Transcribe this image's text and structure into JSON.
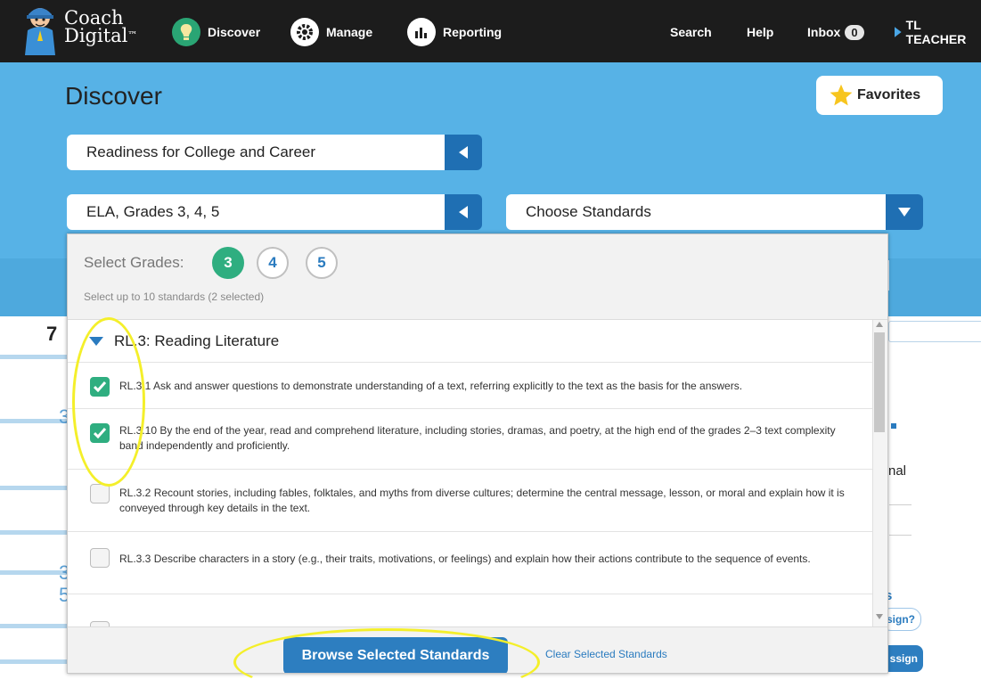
{
  "nav": {
    "logo_line1": "Coach",
    "logo_line2": "Digital",
    "logo_tm": "™",
    "discover": "Discover",
    "manage": "Manage",
    "reporting": "Reporting",
    "search": "Search",
    "help": "Help",
    "inbox": "Inbox",
    "inbox_count": "0",
    "user": "TL TEACHER"
  },
  "page": {
    "title": "Discover",
    "favorites": "Favorites",
    "program_select": "Readiness for College and Career",
    "subject_select": "ELA, Grades 3, 4, 5",
    "standards_select": "Choose Standards"
  },
  "dropdown": {
    "grades_label": "Select Grades:",
    "grades": [
      "3",
      "4",
      "5"
    ],
    "hint": "Select up to 10 standards (2 selected)",
    "group_title": "RL.3: Reading Literature",
    "standards": [
      {
        "text": "RL.3.1 Ask and answer questions to demonstrate understanding of a text, referring explicitly to the text as the basis for the answers.",
        "checked": true
      },
      {
        "text": "RL.3.10 By the end of the year, read and comprehend literature, including stories, dramas, and poetry, at the high end of the grades 2–3 text complexity band independently and proficiently.",
        "checked": true
      },
      {
        "text": "RL.3.2 Recount stories, including fables, folktales, and myths from diverse cultures; determine the central message, lesson, or moral and explain how it is conveyed through key details in the text.",
        "checked": false
      },
      {
        "text": "RL.3.3 Describe characters in a story (e.g., their traits, motivations, or feelings) and explain how their actions contribute to the sequence of events.",
        "checked": false
      }
    ],
    "browse_button": "Browse Selected Standards",
    "clear_link": "Clear Selected Standards"
  },
  "background": {
    "left_number": "7",
    "right_text_1": "nal",
    "right_text_2": "s",
    "right_btn_1": "sign?",
    "right_btn_2": "ssign",
    "strip_digit_1": "3",
    "strip_digit_2": "3",
    "strip_digit_3": "5"
  },
  "colors": {
    "nav_bg": "#1c1c1c",
    "band_blue": "#57b2e6",
    "accent_green": "#2fae80",
    "button_blue": "#2d7ec0",
    "highlight_yellow": "#f4ef2a"
  }
}
